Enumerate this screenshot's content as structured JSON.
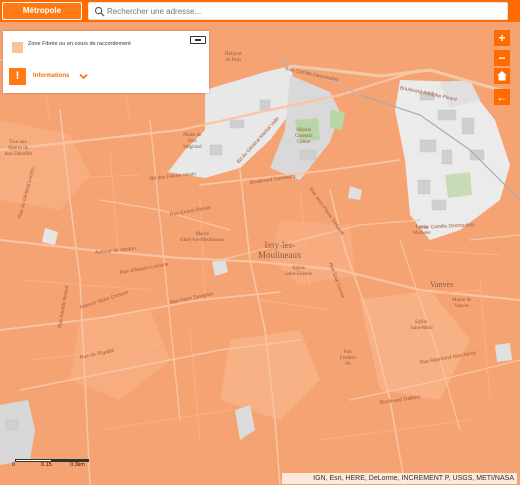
{
  "topbar": {
    "metro_button_label": "Métropole",
    "search_placeholder": "Rechercher une adresse..."
  },
  "legend": {
    "zone_label": "Zone Fibrée ou en cours de raccordement",
    "zone_color": "#f7c29c",
    "info_label": "Informations",
    "info_icon": "!"
  },
  "controls": {
    "zoom_in": "+",
    "zoom_out": "−",
    "home_icon": "home-icon",
    "back": "←"
  },
  "scale": {
    "ticks": [
      "0",
      "0.15",
      "0.3km"
    ]
  },
  "attribution": "IGN, Esri, HERE, DeLorme, INCREMENT P, USGS, METI/NASA",
  "colors": {
    "accent": "#ff6b00",
    "coverage": "#f7a777"
  },
  "map_labels": [
    {
      "text": "Issy-les-\nMoulineaux",
      "size": 9
    },
    {
      "text": "Vanves",
      "size": 8
    },
    {
      "text": "Héliport\nde Paris",
      "size": 5
    },
    {
      "text": "Plaine de\nJeux\nValgirard",
      "size": 5
    },
    {
      "text": "Hôpital\nCorentin\nCelton",
      "size": 5
    },
    {
      "text": "Lycée\nMichelet",
      "size": 5
    },
    {
      "text": "Mairie\nd'Issy-les-Moulineaux",
      "size": 5
    },
    {
      "text": "Eglise\nSaint-Etienne",
      "size": 5
    },
    {
      "text": "Mairie de\nVanves",
      "size": 5
    },
    {
      "text": "Eglise\nSaint-Rémi",
      "size": 5
    },
    {
      "text": "Parc\nFrédéric\nPic",
      "size": 5
    },
    {
      "text": "Tour aux\nfigures de\nJean Dubuffet",
      "size": 5
    }
  ],
  "street_labels": [
    "Rue Camille Desmoulins",
    "Bd du Général Martial Valin",
    "Boulevard Gambetta",
    "Rue Ernest Renan",
    "Avenue de Verdun",
    "Rue Jean-Pierre Timbaud",
    "Avenue Victor Cresson",
    "Rue d'Alsace-Lorraine",
    "Rue de l'Egalité",
    "Rue Aristide Briand",
    "Boulevard Gallieni",
    "Rue Henri Savignac",
    "Rue Sadi Carnot",
    "Rue Raymond Marcheron",
    "Rue Camille Desmoulins",
    "Bd des Frères Voisin",
    "Boulevard Adolphe Pinard",
    "Rue du Général Leclerc"
  ]
}
